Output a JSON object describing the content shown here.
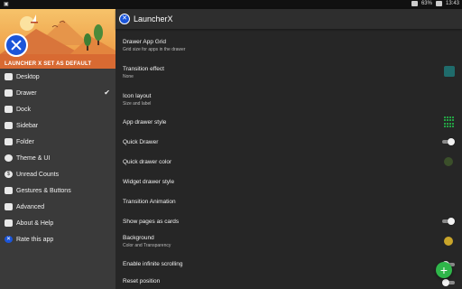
{
  "status": {
    "time": "13:43",
    "battery": "63%"
  },
  "header": {
    "caption": "LAUNCHER X SET AS DEFAULT"
  },
  "app": {
    "title": "LauncherX"
  },
  "nav": [
    {
      "label": "Desktop",
      "icon": "desktop-icon"
    },
    {
      "label": "Drawer",
      "icon": "drawer-icon",
      "checked": "✔"
    },
    {
      "label": "Dock",
      "icon": "dock-icon"
    },
    {
      "label": "Sidebar",
      "icon": "sidebar-icon"
    },
    {
      "label": "Folder",
      "icon": "folder-icon"
    },
    {
      "label": "Theme & UI",
      "icon": "palette-icon"
    },
    {
      "label": "Unread Counts",
      "icon": "unread-counts-icon"
    },
    {
      "label": "Gestures & Buttons",
      "icon": "gesture-icon"
    },
    {
      "label": "Advanced",
      "icon": "advanced-icon"
    },
    {
      "label": "About & Help",
      "icon": "help-icon"
    },
    {
      "label": "Rate this app",
      "icon": "rate-icon"
    }
  ],
  "settings": [
    {
      "title": "Drawer App Grid",
      "subtitle": "Grid size for apps in the drawer"
    },
    {
      "title": "Transition effect",
      "subtitle": "None"
    },
    {
      "title": "Icon layout",
      "subtitle": "Size and label"
    },
    {
      "title": "App drawer style"
    },
    {
      "title": "Quick Drawer",
      "toggle": true
    },
    {
      "title": "Quick drawer color"
    },
    {
      "title": "Widget drawer style"
    },
    {
      "title": "Transition Animation"
    },
    {
      "title": "Show pages as cards",
      "toggle": true
    },
    {
      "title": "Background",
      "subtitle": "Color and Transparency"
    },
    {
      "title": "Enable infinite scrolling",
      "toggle": false
    },
    {
      "title": "Reset position",
      "toggle": false
    }
  ],
  "colors": {
    "transition_swatch": "#1f6b6b",
    "drawer_style_icon": "#23a344",
    "quick_drawer_color": "#3b4f2a",
    "background_color": "#c9a52a",
    "fab": "#2fb64a",
    "accent_blue": "#1b55d9"
  },
  "fab": {
    "label": "+"
  }
}
